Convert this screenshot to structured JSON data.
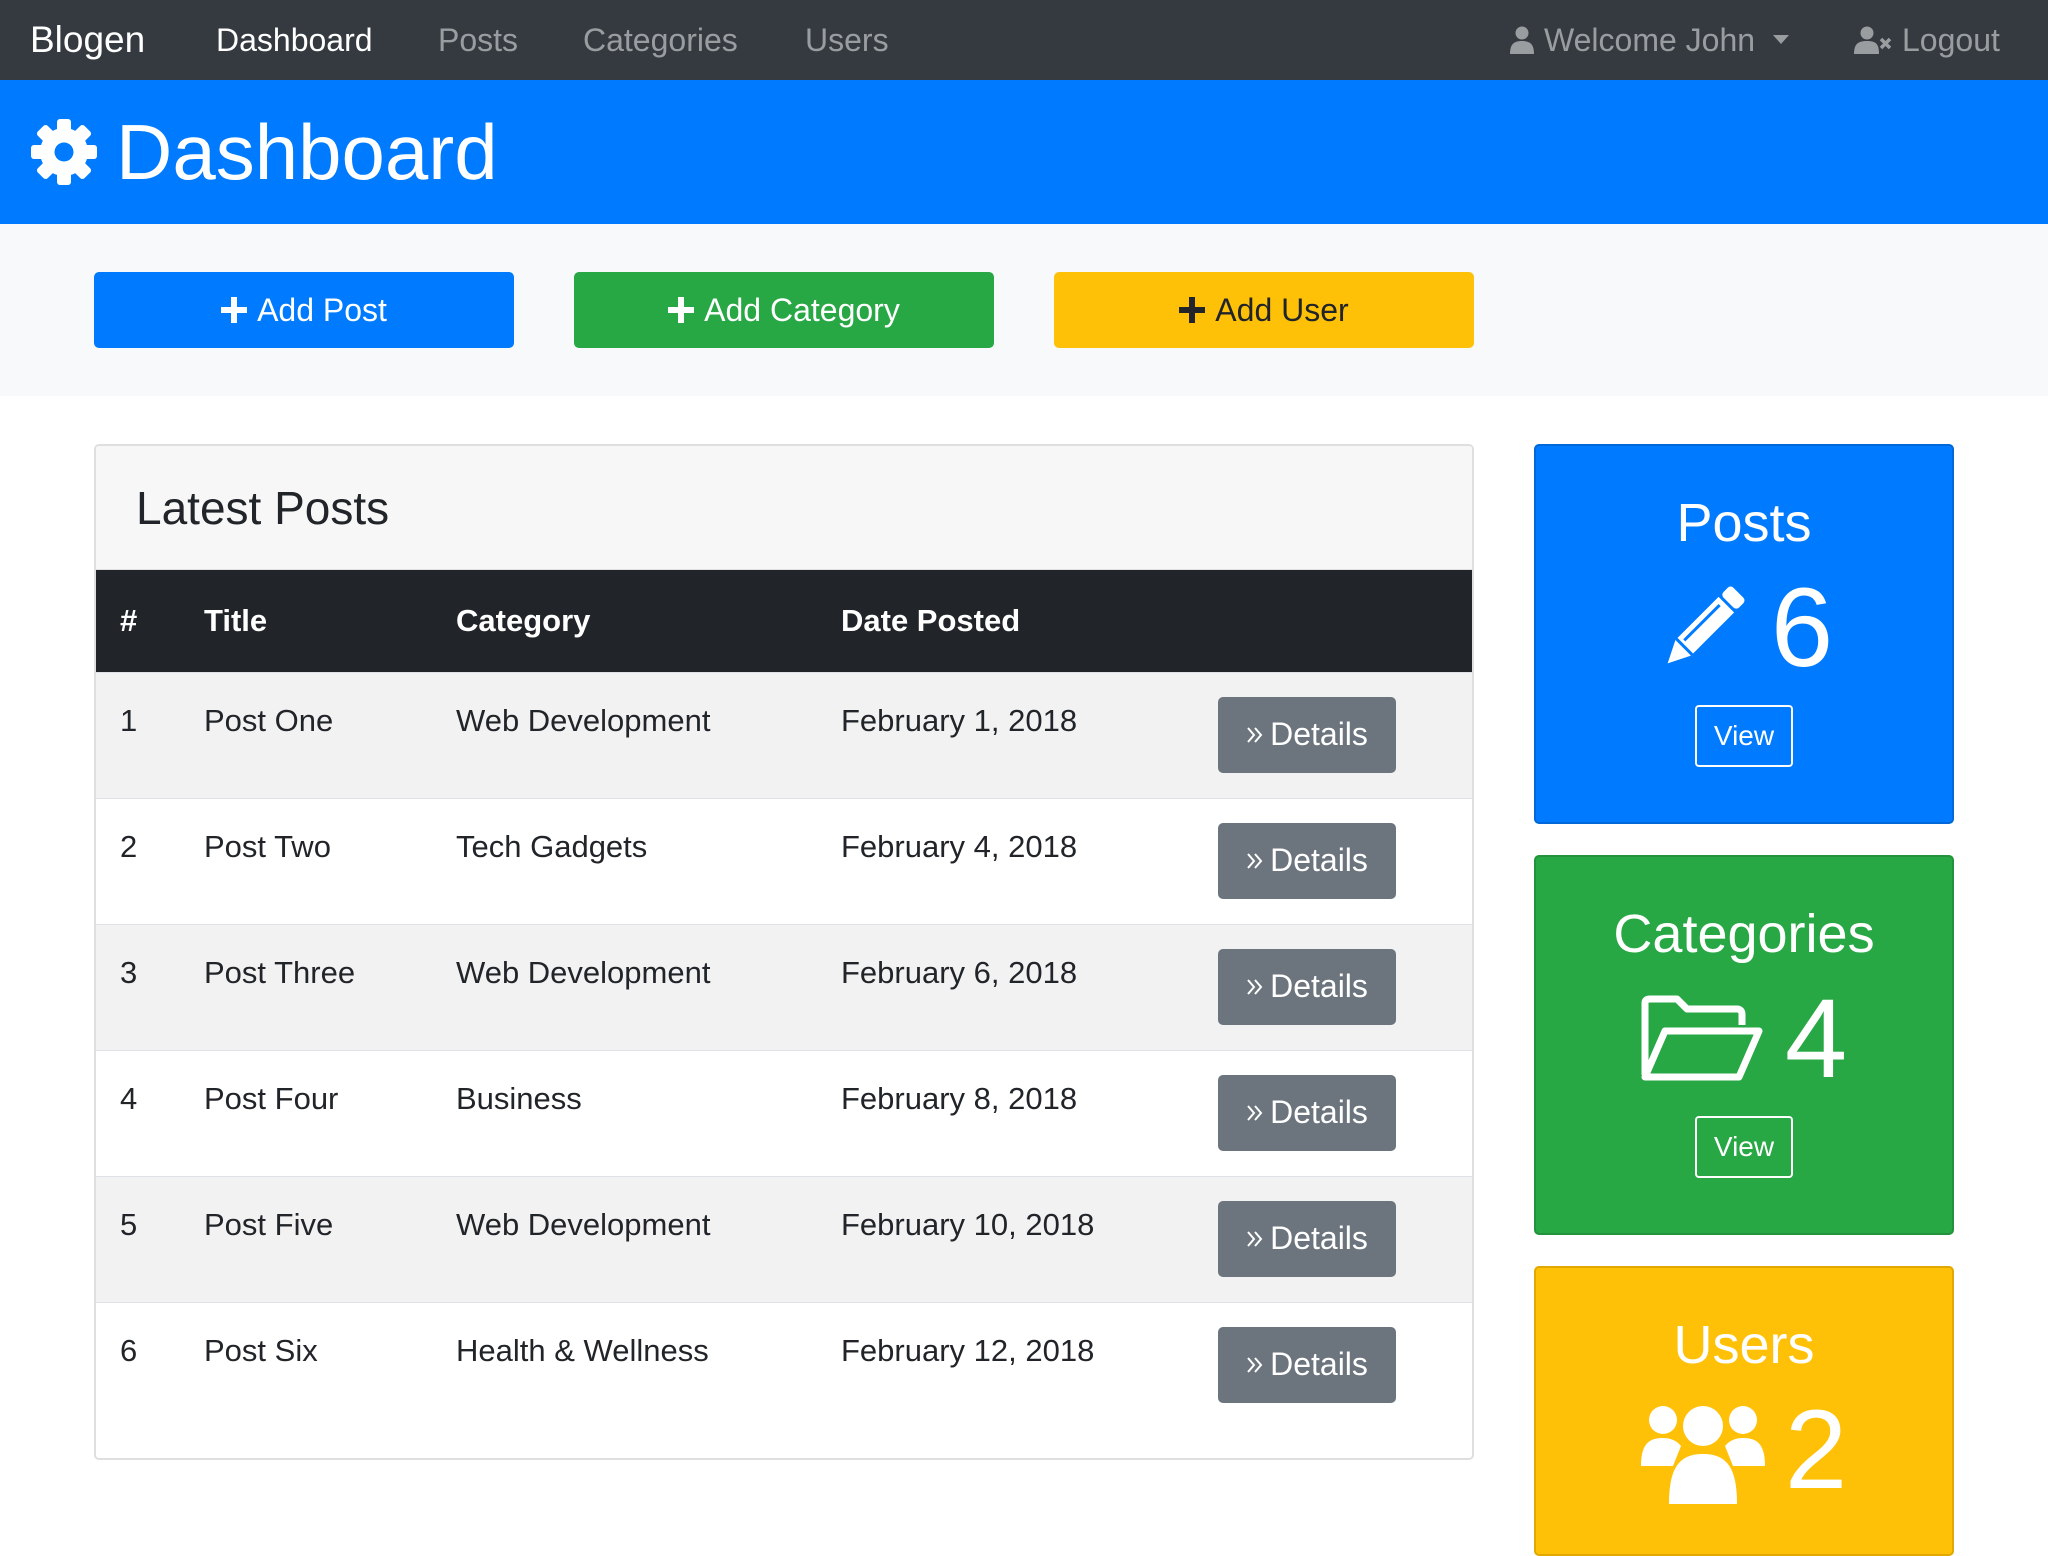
{
  "navbar": {
    "brand": "Blogen",
    "links": [
      "Dashboard",
      "Posts",
      "Categories",
      "Users"
    ],
    "welcome": "Welcome John",
    "logout": "Logout"
  },
  "header": {
    "title": "Dashboard"
  },
  "actions": {
    "add_post": "Add Post",
    "add_category": "Add Category",
    "add_user": "Add User"
  },
  "posts_table": {
    "title": "Latest Posts",
    "columns": [
      "#",
      "Title",
      "Category",
      "Date Posted"
    ],
    "rows": [
      {
        "num": "1",
        "title": "Post One",
        "category": "Web Development",
        "date": "February 1, 2018",
        "action": "Details"
      },
      {
        "num": "2",
        "title": "Post Two",
        "category": "Tech Gadgets",
        "date": "February 4, 2018",
        "action": "Details"
      },
      {
        "num": "3",
        "title": "Post Three",
        "category": "Web Development",
        "date": "February 6, 2018",
        "action": "Details"
      },
      {
        "num": "4",
        "title": "Post Four",
        "category": "Business",
        "date": "February 8, 2018",
        "action": "Details"
      },
      {
        "num": "5",
        "title": "Post Five",
        "category": "Web Development",
        "date": "February 10, 2018",
        "action": "Details"
      },
      {
        "num": "6",
        "title": "Post Six",
        "category": "Health & Wellness",
        "date": "February 12, 2018",
        "action": "Details"
      }
    ]
  },
  "stats": {
    "posts": {
      "title": "Posts",
      "count": "6",
      "button": "View"
    },
    "categories": {
      "title": "Categories",
      "count": "4",
      "button": "View"
    },
    "users": {
      "title": "Users",
      "count": "2"
    }
  },
  "colors": {
    "navbar": "#343a40",
    "primary": "#007bff",
    "success": "#28a745",
    "warning": "#ffc107",
    "secondary": "#6c757d",
    "table_head": "#212529"
  },
  "icons": {
    "header": "gear-icon",
    "user": "user-icon",
    "logout": "user-times-icon",
    "add": "plus-icon",
    "details": "double-chevron-right-icon",
    "posts": "pencil-icon",
    "categories": "folder-open-icon",
    "users": "users-icon"
  }
}
